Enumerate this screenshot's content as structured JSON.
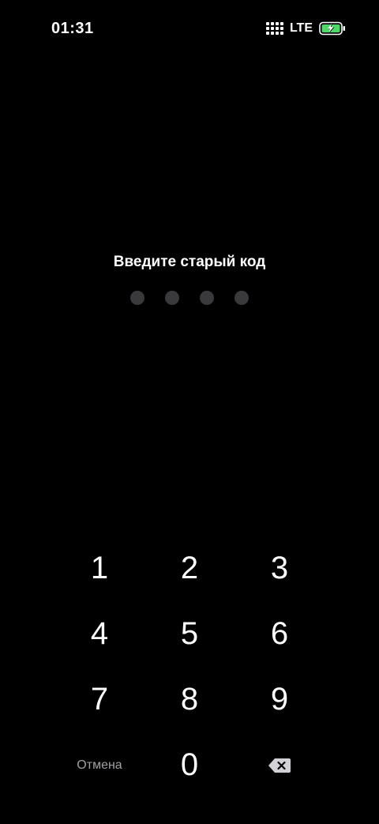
{
  "status_bar": {
    "time": "01:31",
    "network": "LTE",
    "icons": [
      "signal-icon",
      "battery-charging-icon"
    ]
  },
  "prompt": {
    "title": "Введите старый код",
    "passcode_length": 4,
    "entered": 0
  },
  "keypad": {
    "keys": [
      "1",
      "2",
      "3",
      "4",
      "5",
      "6",
      "7",
      "8",
      "9"
    ],
    "zero": "0",
    "cancel_label": "Отмена",
    "delete_icon": "backspace-icon"
  },
  "colors": {
    "background": "#000000",
    "text": "#ffffff",
    "dot_empty": "#3a3a3c",
    "secondary_text": "#a0a0a4",
    "battery_green": "#4cd964"
  }
}
